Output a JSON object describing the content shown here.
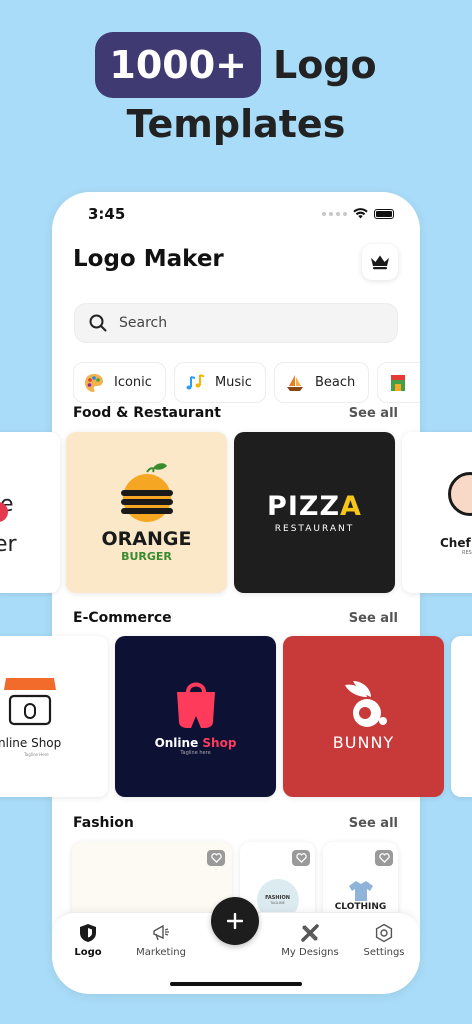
{
  "hero": {
    "highlight": "1000+",
    "word": "Logo",
    "line2": "Templates"
  },
  "status": {
    "time": "3:45"
  },
  "app": {
    "title": "Logo Maker"
  },
  "search": {
    "placeholder": "Search"
  },
  "chips": [
    {
      "label": "Iconic",
      "icon": "palette-icon"
    },
    {
      "label": "Music",
      "icon": "music-notes-icon"
    },
    {
      "label": "Beach",
      "icon": "sailboat-icon"
    },
    {
      "label": "",
      "icon": "shop-icon"
    }
  ],
  "sections": {
    "food": {
      "title": "Food & Restaurant",
      "see_all": "See all"
    },
    "ecommerce": {
      "title": "E-Commerce",
      "see_all": "See all"
    },
    "fashion": {
      "title": "Fashion",
      "see_all": "See all"
    }
  },
  "cards": {
    "food_left": {
      "line1": "e",
      "line2": "er"
    },
    "orange": {
      "line1": "ORANGE",
      "line2": "BURGER"
    },
    "pizza": {
      "line1": "PIZZ",
      "line1_accent": "A",
      "line2": "RESTAURANT"
    },
    "chef": {
      "line1": "Chef",
      "line2": "RES"
    },
    "shop_left": {
      "line1": "nline Shop",
      "line2": "Tagline Here"
    },
    "online_shop": {
      "line1": "Online ",
      "line1_accent": "Shop",
      "line2": "Tagline here"
    },
    "bunny": {
      "line1": "BUNNY"
    },
    "fashion_round": {
      "line1": "FASHION",
      "line2": "TAGLINE"
    },
    "clothing": {
      "line1": "CLOTHING",
      "line2": "FASHION"
    }
  },
  "nav": {
    "logo": "Logo",
    "marketing": "Marketing",
    "my_designs": "My Designs",
    "settings": "Settings"
  },
  "colors": {
    "background": "#a9dcf8",
    "hero_pill": "#3f3a72",
    "orange_card": "#fae8c8",
    "pizza_card": "#1e1e1e",
    "shop_card": "#0d1235",
    "bunny_card": "#c83a3a",
    "pizza_accent": "#f5c518",
    "shop_accent": "#ff3b5c"
  }
}
